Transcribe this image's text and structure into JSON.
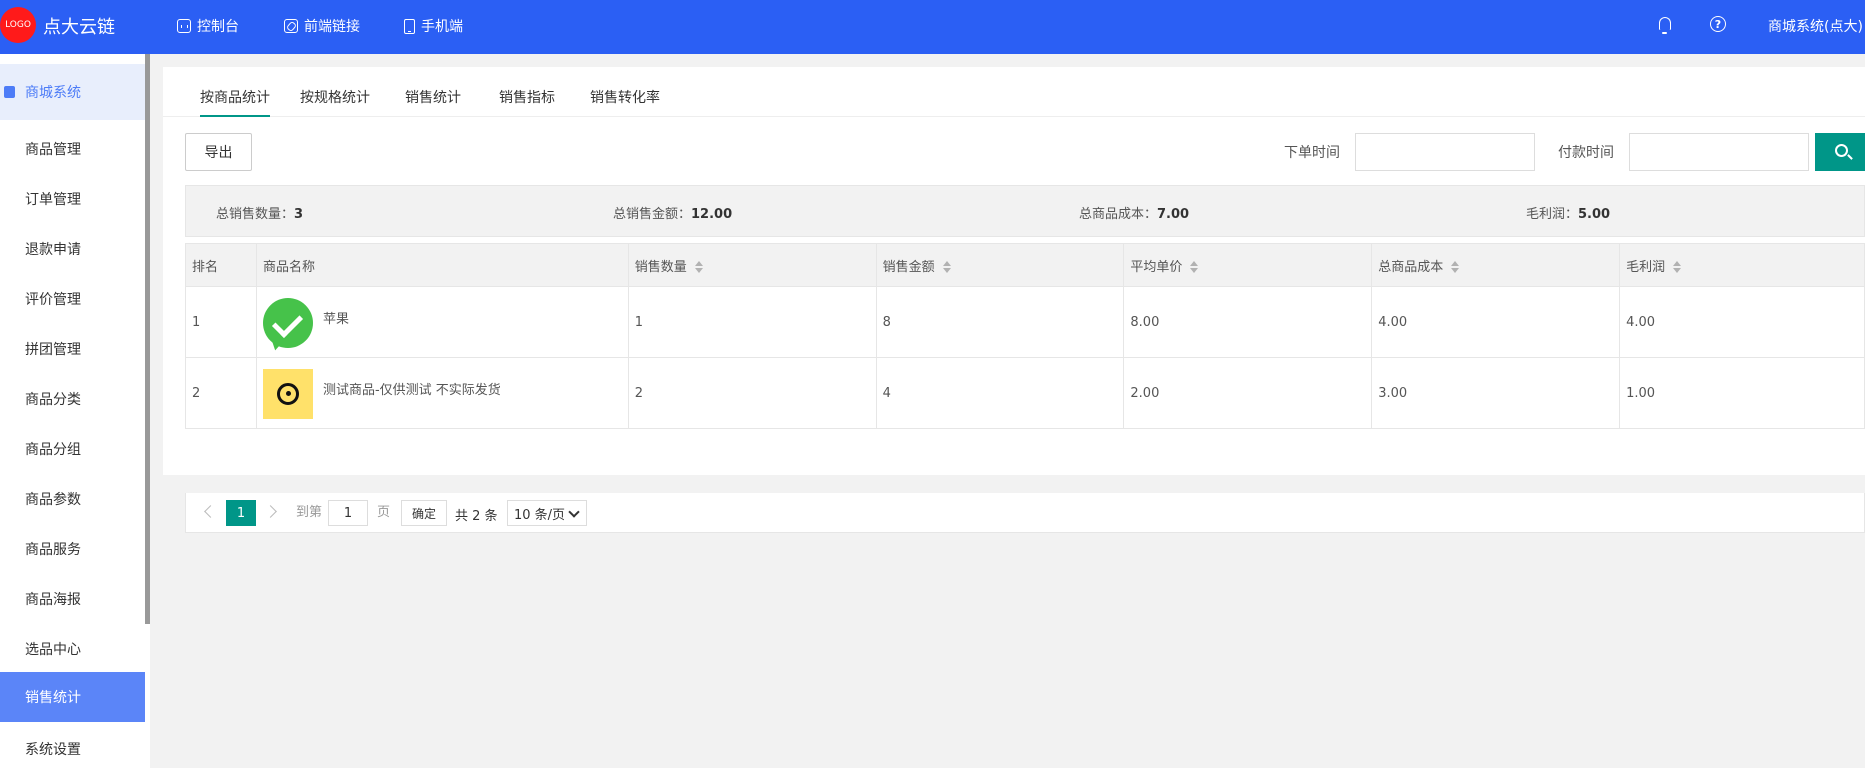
{
  "header": {
    "logo_text": "LOGO",
    "brand": "点大云链",
    "nav": [
      {
        "label": "控制台",
        "icon": "console-icon"
      },
      {
        "label": "前端链接",
        "icon": "link-icon"
      },
      {
        "label": "手机端",
        "icon": "phone-icon"
      }
    ],
    "user": "商城系统(点大)",
    "colors": {
      "header_bg": "#2b5ff4",
      "accent": "#009688"
    }
  },
  "sidebar": {
    "section": "商城系统",
    "items": [
      "商品管理",
      "订单管理",
      "退款申请",
      "评价管理",
      "拼团管理",
      "商品分类",
      "商品分组",
      "商品参数",
      "商品服务",
      "商品海报",
      "选品中心",
      "销售统计",
      "系统设置"
    ],
    "active": "销售统计"
  },
  "tabs": [
    "按商品统计",
    "按规格统计",
    "销售统计",
    "销售指标",
    "销售转化率"
  ],
  "toolbar": {
    "export_label": "导出",
    "order_time_label": "下单时间",
    "pay_time_label": "付款时间"
  },
  "summary": {
    "qty_label": "总销售数量：",
    "qty": "3",
    "amount_label": "总销售金额：",
    "amount": "12.00",
    "cost_label": "总商品成本：",
    "cost": "7.00",
    "profit_label": "毛利润：",
    "profit": "5.00"
  },
  "table": {
    "columns": [
      "排名",
      "商品名称",
      "销售数量",
      "销售金额",
      "平均单价",
      "总商品成本",
      "毛利润"
    ],
    "rows": [
      {
        "rank": "1",
        "name": "苹果",
        "qty": "1",
        "amount": "8",
        "avg": "8.00",
        "cost": "4.00",
        "profit": "4.00"
      },
      {
        "rank": "2",
        "name": "测试商品-仅供测试 不实际发货",
        "qty": "2",
        "amount": "4",
        "avg": "2.00",
        "cost": "3.00",
        "profit": "1.00"
      }
    ]
  },
  "pager": {
    "current": "1",
    "goto_label": "到第",
    "goto_value": "1",
    "page_label": "页",
    "ok_label": "确定",
    "total": "共 2 条",
    "page_size": "10 条/页"
  }
}
